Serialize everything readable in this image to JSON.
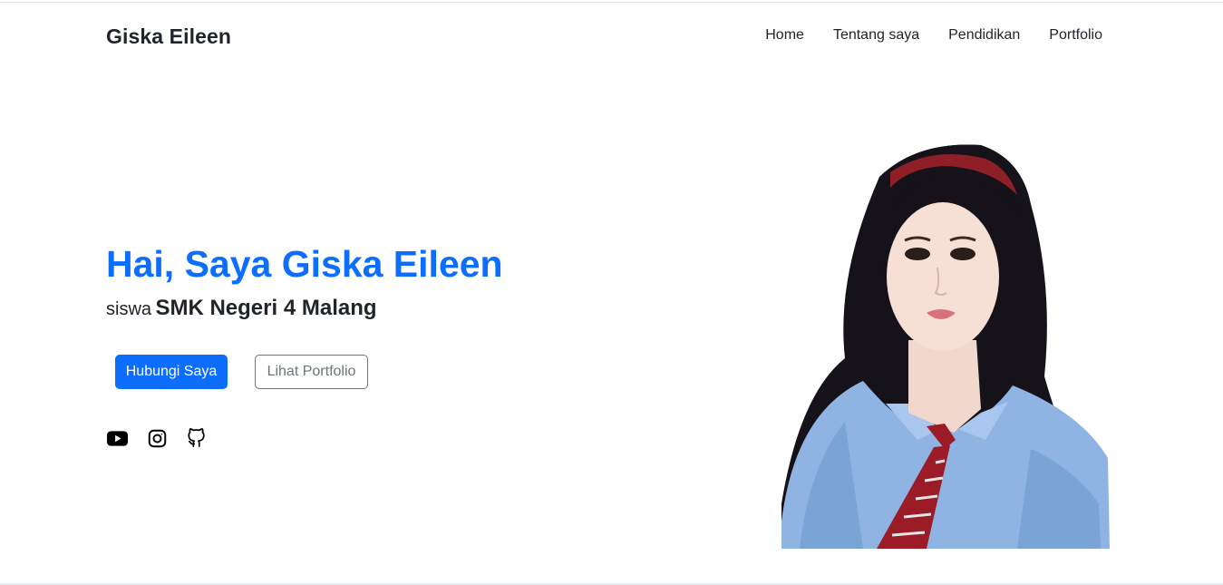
{
  "nav": {
    "brand": "Giska Eileen",
    "links": [
      {
        "label": "Home"
      },
      {
        "label": "Tentang saya"
      },
      {
        "label": "Pendidikan"
      },
      {
        "label": "Portfolio"
      }
    ]
  },
  "hero": {
    "title": "Hai, Saya Giska Eileen",
    "subtitle_prefix": "siswa",
    "subtitle_school": "SMK Negeri 4 Malang",
    "primary_button": "Hubungi Saya",
    "secondary_button": "Lihat Portfolio",
    "social_icons": [
      "youtube-icon",
      "instagram-icon",
      "github-icon"
    ]
  },
  "colors": {
    "accent": "#0d6efd",
    "text": "#212529",
    "muted": "#6c757d"
  }
}
